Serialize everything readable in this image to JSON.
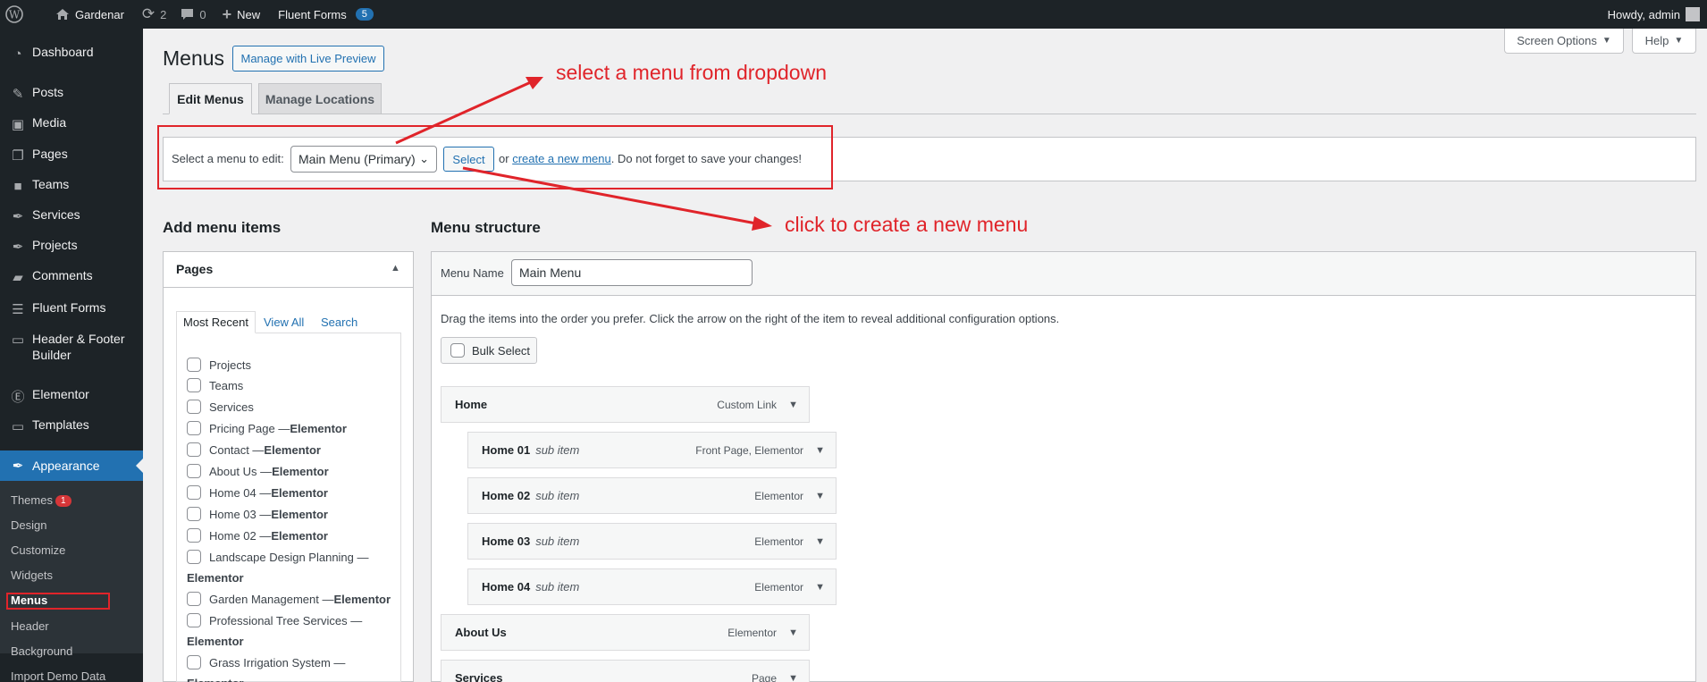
{
  "adminbar": {
    "site_name": "Gardenar",
    "updates_count": "2",
    "comments_count": "0",
    "new_label": "New",
    "fluent_forms_label": "Fluent Forms",
    "fluent_forms_badge": "5",
    "howdy": "Howdy, admin"
  },
  "sidebar": {
    "dashboard": "Dashboard",
    "posts": "Posts",
    "media": "Media",
    "pages": "Pages",
    "teams": "Teams",
    "services": "Services",
    "projects": "Projects",
    "comments": "Comments",
    "fluent_forms": "Fluent Forms",
    "header_footer": "Header & Footer Builder",
    "elementor": "Elementor",
    "templates": "Templates",
    "appearance": "Appearance",
    "sub": {
      "themes": "Themes",
      "themes_badge": "1",
      "design": "Design",
      "customize": "Customize",
      "widgets": "Widgets",
      "menus": "Menus",
      "header": "Header",
      "background": "Background",
      "import_demo": "Import Demo Data"
    }
  },
  "header": {
    "title": "Menus",
    "live_preview": "Manage with Live Preview",
    "screen_options": "Screen Options",
    "help": "Help"
  },
  "tabs": {
    "edit": "Edit Menus",
    "locations": "Manage Locations"
  },
  "select_bar": {
    "label": "Select a menu to edit:",
    "selected": "Main Menu (Primary)",
    "button": "Select",
    "or": "or",
    "create_link": "create a new menu",
    "suffix": ". Do not forget to save your changes!"
  },
  "annotations": {
    "dropdown": "select a menu from dropdown",
    "create": "click to create a new menu"
  },
  "add_items": {
    "title": "Add menu items",
    "panel_title": "Pages",
    "tab_recent": "Most Recent",
    "tab_all": "View All",
    "tab_search": "Search",
    "items": [
      {
        "name": "Projects",
        "suffix": ""
      },
      {
        "name": "Teams",
        "suffix": ""
      },
      {
        "name": "Services",
        "suffix": ""
      },
      {
        "name": "Pricing Page — ",
        "suffix": "Elementor"
      },
      {
        "name": "Contact — ",
        "suffix": "Elementor"
      },
      {
        "name": "About Us — ",
        "suffix": "Elementor"
      },
      {
        "name": "Home 04 — ",
        "suffix": "Elementor"
      },
      {
        "name": "Home 03 — ",
        "suffix": "Elementor"
      },
      {
        "name": "Home 02 — ",
        "suffix": "Elementor"
      },
      {
        "name": "Landscape Design Planning —",
        "suffix": ""
      },
      {
        "name": "Garden Management — ",
        "suffix": "Elementor"
      },
      {
        "name": "Professional Tree Services —",
        "suffix": ""
      },
      {
        "name": "Grass Irrigation  System —",
        "suffix": ""
      }
    ],
    "continuation": "Elementor"
  },
  "structure": {
    "title": "Menu structure",
    "name_label": "Menu Name",
    "name_value": "Main Menu",
    "instructions": "Drag the items into the order you prefer. Click the arrow on the right of the item to reveal additional configuration options.",
    "bulk_select": "Bulk Select",
    "items": [
      {
        "title": "Home",
        "sub": "",
        "type": "Custom Link"
      },
      {
        "title": "Home 01",
        "sub": "sub item",
        "type": "Front Page, Elementor"
      },
      {
        "title": "Home 02",
        "sub": "sub item",
        "type": "Elementor"
      },
      {
        "title": "Home 03",
        "sub": "sub item",
        "type": "Elementor"
      },
      {
        "title": "Home 04",
        "sub": "sub item",
        "type": "Elementor"
      },
      {
        "title": "About Us",
        "sub": "",
        "type": "Elementor"
      },
      {
        "title": "Services",
        "sub": "",
        "type": "Page"
      }
    ]
  },
  "colors": {
    "accent": "#2271b1",
    "annotation_red": "#e0242a",
    "admin_dark": "#1d2327"
  }
}
